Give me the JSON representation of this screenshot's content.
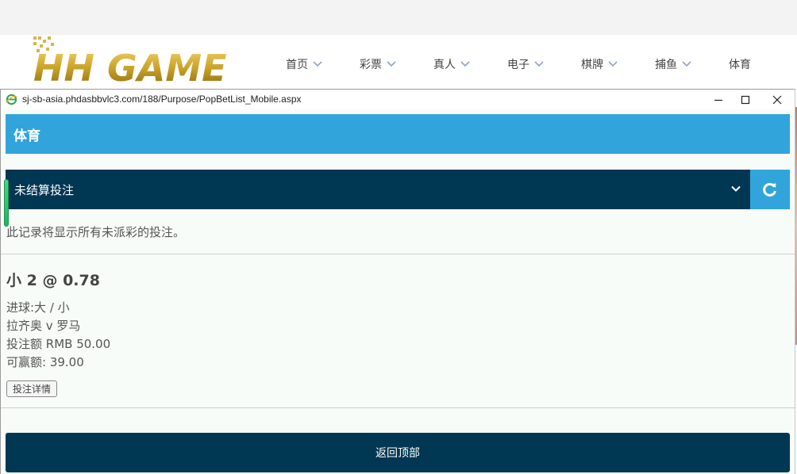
{
  "site": {
    "logo_text": "HH GAME",
    "nav": [
      {
        "label": "首页"
      },
      {
        "label": "彩票"
      },
      {
        "label": "真人"
      },
      {
        "label": "电子"
      },
      {
        "label": "棋牌"
      },
      {
        "label": "捕鱼"
      },
      {
        "label": "体育"
      }
    ]
  },
  "popup": {
    "url": "sj-sb-asia.phdasbbvlc3.com/188/Purpose/PopBetList_Mobile.aspx",
    "header_title": "体育",
    "select_label": "未结算投注",
    "notice": "此记录将显示所有未派彩的投注。",
    "bet": {
      "title": "小 2 @ 0.78",
      "market": "进球:大 / 小",
      "match": "拉齐奥 v 罗马",
      "stake": "投注额 RMB 50.00",
      "win": "可赢额: 39.00",
      "detail_label": "投注详情"
    },
    "back_top_label": "返回顶部"
  },
  "colors": {
    "header_blue": "#32a4dc",
    "dark_navy": "#003752",
    "content_bg": "#f7fcf8",
    "logo_gold": "#c9a227"
  },
  "icons": [
    "ie-icon",
    "minimize-icon",
    "maximize-icon",
    "close-icon",
    "chevron-down-icon",
    "refresh-icon"
  ]
}
